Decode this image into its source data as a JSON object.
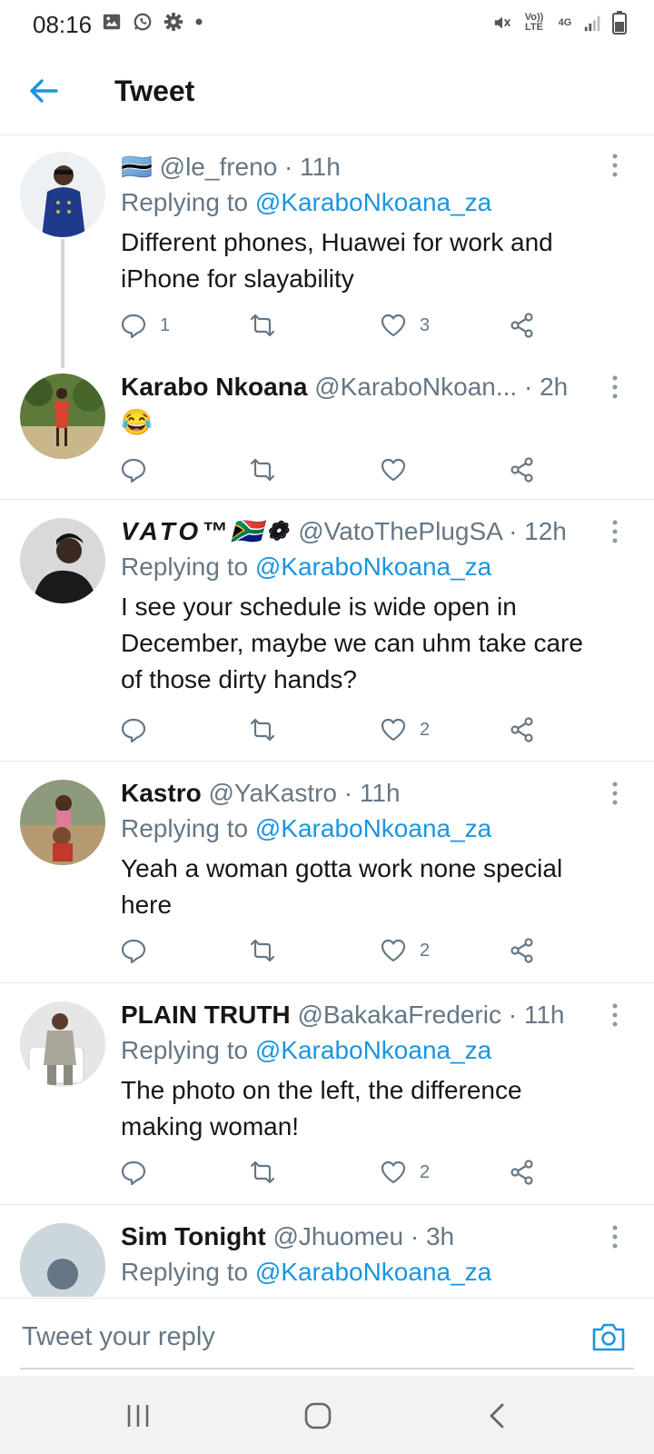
{
  "status_bar": {
    "time": "08:16",
    "left_icons": [
      "image-icon",
      "whatsapp-icon",
      "settings-icon",
      "dot-icon"
    ],
    "volte_label": "Vo)) LTE",
    "network_label": "4G"
  },
  "header": {
    "title": "Tweet",
    "back_icon": "arrow-left-icon"
  },
  "colors": {
    "accent": "#1b95e0",
    "text": "#14171a",
    "muted": "#657786",
    "divider": "#e1e8ed"
  },
  "tweets": [
    {
      "name": "",
      "name_prefix_emoji": "🇧🇼",
      "handle": "@le_freno",
      "time": "· 11h",
      "replying_label": "Replying to",
      "replying_to": "@KaraboNkoana_za",
      "text": "Different phones, Huawei for work and iPhone for slayability",
      "replies": "1",
      "retweets": "",
      "likes": "3"
    },
    {
      "name": "Karabo Nkoana",
      "handle": "@KaraboNkoan...",
      "time": "· 2h",
      "text": "😂",
      "replies": "",
      "retweets": "",
      "likes": ""
    },
    {
      "name": "VATO™🇿🇦❁",
      "handle": "@VatoThePlugSA",
      "time": "· 12h",
      "replying_label": "Replying to",
      "replying_to": "@KaraboNkoana_za",
      "text": "I see your schedule is wide open in December, maybe we can uhm take care of those dirty hands?",
      "replies": "",
      "retweets": "",
      "likes": "2"
    },
    {
      "name": "Kastro",
      "handle": "@YaKastro",
      "time": "· 11h",
      "replying_label": "Replying to",
      "replying_to": "@KaraboNkoana_za",
      "text": "Yeah a woman gotta work none special here",
      "replies": "",
      "retweets": "",
      "likes": "2"
    },
    {
      "name": "PLAIN TRUTH",
      "handle": "@BakakaFrederic",
      "time": "· 11h",
      "replying_label": "Replying to",
      "replying_to": "@KaraboNkoana_za",
      "text": "The photo on the left, the difference making woman!",
      "replies": "",
      "retweets": "",
      "likes": "2"
    },
    {
      "name": "Sim Tonight",
      "handle": "@Jhuomeu",
      "time": "· 3h",
      "replying_label": "Replying to",
      "replying_to": "@KaraboNkoana_za"
    }
  ],
  "composer": {
    "placeholder": "Tweet your reply",
    "camera_icon": "camera-icon"
  },
  "nav_bar": {
    "buttons": [
      "recents-icon",
      "home-icon",
      "back-icon"
    ]
  }
}
